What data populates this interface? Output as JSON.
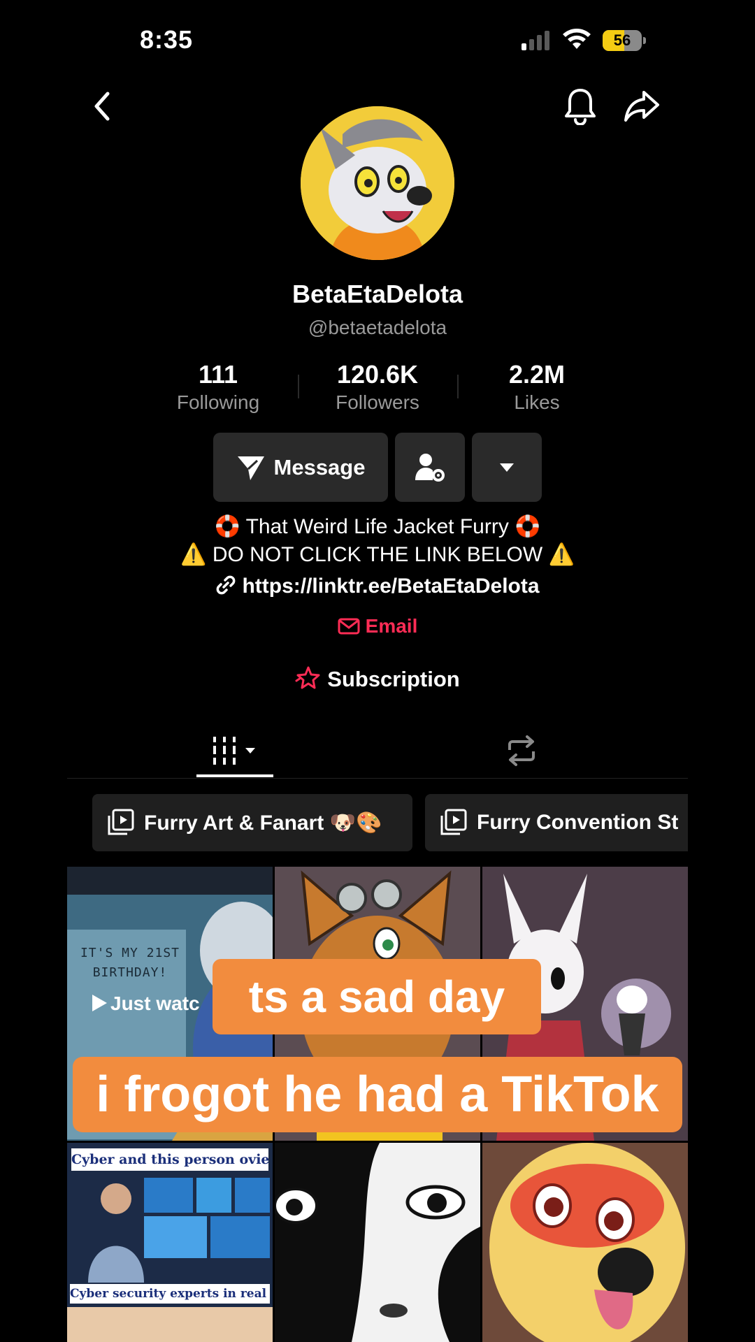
{
  "status_bar": {
    "time": "8:35",
    "battery_level": "56"
  },
  "profile": {
    "display_name": "BetaEtaDelota",
    "handle": "@betaetadelota"
  },
  "stats": [
    {
      "value": "111",
      "label": "Following"
    },
    {
      "value": "120.6K",
      "label": "Followers"
    },
    {
      "value": "2.2M",
      "label": "Likes"
    }
  ],
  "actions": {
    "message_label": "Message"
  },
  "bio": {
    "line1": "🛟 That Weird Life Jacket Furry 🛟",
    "line2": "⚠️ DO NOT CLICK THE LINK BELOW ⚠️",
    "link": "https://linktr.ee/BetaEtaDelota",
    "email_label": "Email",
    "subscription_label": "Subscription"
  },
  "playlists": [
    {
      "label": "Furry Art & Fanart 🐶🎨"
    },
    {
      "label": "Furry Convention St"
    }
  ],
  "grid": {
    "cell1_text": "IT'S MY 21ST BIRTHDAY!",
    "cell1_badge": "Just watc",
    "cell4_title": "Cyber and this person ovies",
    "cell4_subtitle": "Cyber security experts in real life"
  },
  "overlay_captions": {
    "caption1": "ts a sad day",
    "caption2": "i frogot he had a TikTok"
  },
  "colors": {
    "accent_red": "#fe2c55",
    "caption_orange": "#f28c3e",
    "battery_yellow": "#f4cc13"
  }
}
